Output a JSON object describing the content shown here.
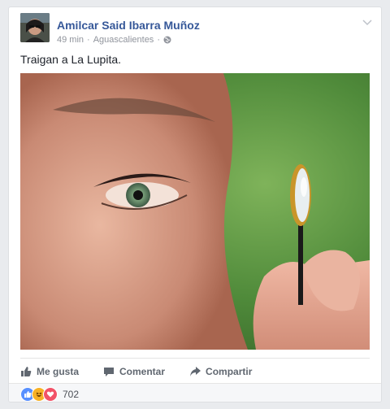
{
  "post": {
    "author": "Amilcar Said Ibarra Muñoz",
    "time": "49 min",
    "separator": "·",
    "location": "Aguascalientes",
    "separator2": "·",
    "text": "Traigan a La Lupita.",
    "icons": {
      "privacy": "globe-icon",
      "menu": "chevron-down-icon"
    }
  },
  "actions": {
    "like": "Me gusta",
    "comment": "Comentar",
    "share": "Compartir"
  },
  "reactions": {
    "count": "702",
    "types": [
      "like",
      "haha",
      "love"
    ],
    "colors": {
      "like": "#5890ff",
      "haha": "#f7b125",
      "love": "#f25268"
    }
  },
  "colors": {
    "author": "#365899",
    "background": "#e9ebee"
  }
}
